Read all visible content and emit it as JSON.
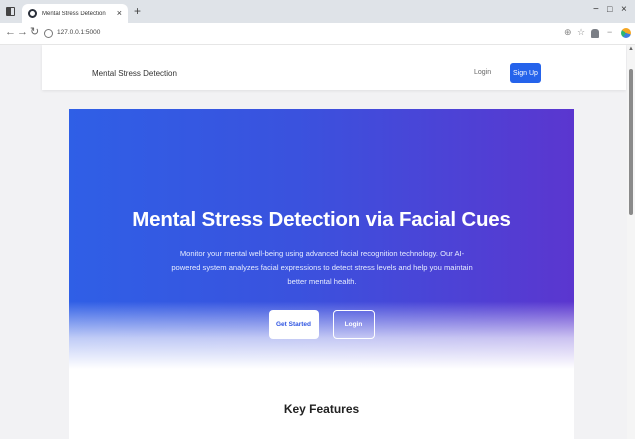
{
  "browser": {
    "tab_title": "Mental Stress Detection",
    "tab_close": "×",
    "new_tab": "+",
    "url": "127.0.0.1:5000",
    "nav_back": "←",
    "nav_forward": "→",
    "nav_reload": "↻",
    "window_min": "−",
    "window_max": "□",
    "window_close": "×",
    "icons": [
      "tab-strip-icon",
      "favicon-icon",
      "info-icon",
      "zoom-icon",
      "star-icon",
      "extensions-icon",
      "minimize-icon",
      "edge-icon"
    ]
  },
  "navbar": {
    "brand": "Mental Stress Detection",
    "login": "Login",
    "signup": "Sign Up"
  },
  "hero": {
    "title": "Mental Stress Detection via Facial Cues",
    "description": "Monitor your mental well-being using advanced facial recognition technology. Our AI-powered system analyzes facial expressions to detect stress levels and help you maintain better mental health.",
    "get_started": "Get Started",
    "login": "Login"
  },
  "features": {
    "title": "Key Features"
  },
  "colors": {
    "primary": "#2563eb",
    "hero_start": "#2f5fe6",
    "hero_end": "#5b36cf"
  }
}
